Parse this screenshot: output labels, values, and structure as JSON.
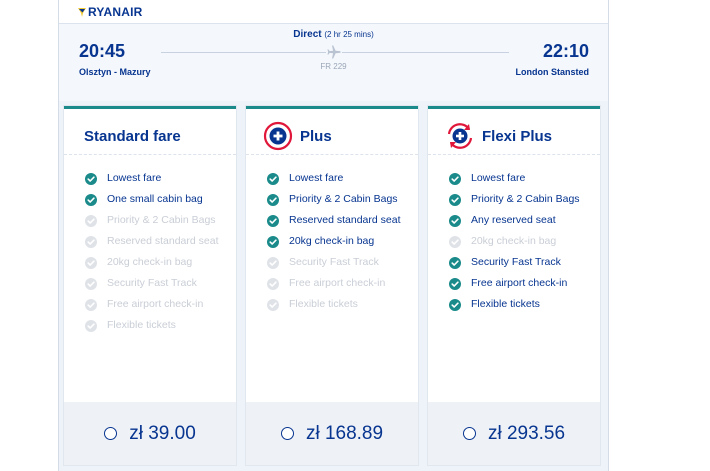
{
  "header": {
    "brand": "RYANAIR"
  },
  "flight": {
    "departure_time": "20:45",
    "departure_city": "Olsztyn - Mazury",
    "arrival_time": "22:10",
    "arrival_city": "London Stansted",
    "type": "Direct",
    "duration": "(2 hr 25 mins)",
    "flight_number": "FR 229"
  },
  "colors": {
    "brand_navy": "#073590",
    "teal": "#1a8a8a",
    "plus_red": "#e0173a"
  },
  "fares": [
    {
      "title": "Standard fare",
      "icon": "none",
      "price": "zł 39.00",
      "features": [
        {
          "label": "Lowest fare",
          "included": true
        },
        {
          "label": "One small cabin bag",
          "included": true
        },
        {
          "label": "Priority & 2 Cabin Bags",
          "included": false
        },
        {
          "label": "Reserved standard seat",
          "included": false
        },
        {
          "label": "20kg check-in bag",
          "included": false
        },
        {
          "label": "Security Fast Track",
          "included": false
        },
        {
          "label": "Free airport check-in",
          "included": false
        },
        {
          "label": "Flexible tickets",
          "included": false
        }
      ]
    },
    {
      "title": "Plus",
      "icon": "plus-circle-icon",
      "price": "zł 168.89",
      "features": [
        {
          "label": "Lowest fare",
          "included": true
        },
        {
          "label": "Priority & 2 Cabin Bags",
          "included": true
        },
        {
          "label": "Reserved standard seat",
          "included": true
        },
        {
          "label": "20kg check-in bag",
          "included": true
        },
        {
          "label": "Security Fast Track",
          "included": false
        },
        {
          "label": "Free airport check-in",
          "included": false
        },
        {
          "label": "Flexible tickets",
          "included": false
        }
      ]
    },
    {
      "title": "Flexi Plus",
      "icon": "flexi-plus-icon",
      "price": "zł 293.56",
      "features": [
        {
          "label": "Lowest fare",
          "included": true
        },
        {
          "label": "Priority & 2 Cabin Bags",
          "included": true
        },
        {
          "label": "Any reserved seat",
          "included": true
        },
        {
          "label": "20kg check-in bag",
          "included": false
        },
        {
          "label": "Security Fast Track",
          "included": true
        },
        {
          "label": "Free airport check-in",
          "included": true
        },
        {
          "label": "Flexible tickets",
          "included": true
        }
      ]
    }
  ]
}
